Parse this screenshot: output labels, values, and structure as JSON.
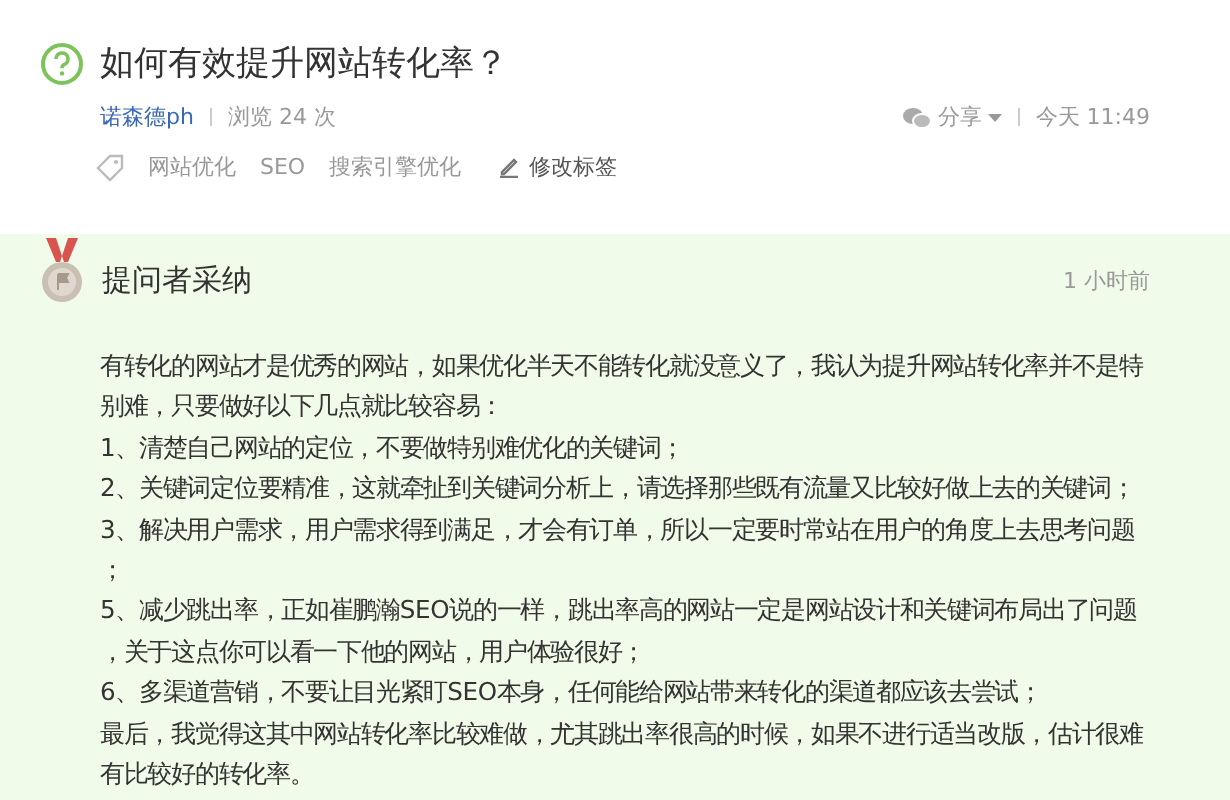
{
  "question": {
    "title": "如何有效提升网站转化率？",
    "author": "诺森德ph",
    "views": "浏览 24 次",
    "share": "分享",
    "time": "今天 11:49"
  },
  "tags": [
    {
      "label": "网站优化",
      "kind": "tag"
    },
    {
      "label": "SEO",
      "kind": "tag"
    },
    {
      "label": "搜索引擎优化",
      "kind": "tag"
    },
    {
      "label": "修改标签",
      "kind": "edit"
    }
  ],
  "answer": {
    "badge": "提问者采纳",
    "time": "1 小时前",
    "lines": [
      "有转化的网站才是优秀的网站，如果优化半天不能转化就没意义了，我认为提升网站转化率并不是特",
      "别难，只要做好以下几点就比较容易：",
      "1、清楚自己网站的定位，不要做特别难优化的关键词；",
      "2、关键词定位要精准，这就牵扯到关键词分析上，请选择那些既有流量又比较好做上去的关键词；",
      "3、解决用户需求，用户需求得到满足，才会有订单，所以一定要时常站在用户的角度上去思考问题",
      "；",
      "5、减少跳出率，正如崔鹏瀚SEO说的一样，跳出率高的网站一定是网站设计和关键词布局出了问题",
      "，关于这点你可以看一下他的网站，用户体验很好；",
      "6、多渠道营销，不要让目光紧盯SEO本身，任何能给网站带来转化的渠道都应该去尝试；",
      "最后，我觉得这其中网站转化率比较难做，尤其跳出率很高的时候，如果不进行适当改版，估计很难",
      "有比较好的转化率。"
    ]
  }
}
